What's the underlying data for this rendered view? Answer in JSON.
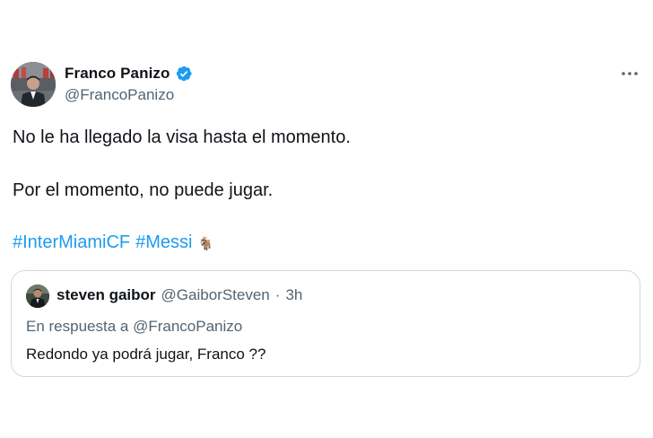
{
  "author": {
    "name": "Franco Panizo",
    "handle": "@FrancoPanizo",
    "verified": true,
    "verified_color": "#1d9bf0"
  },
  "tweet": {
    "line1": "No le ha llegado la visa hasta el momento.",
    "line2": "Por el momento, no puede jugar.",
    "hashtags": [
      "#InterMiamiCF",
      "#Messi"
    ],
    "emoji": "🐐"
  },
  "quoted": {
    "name": "steven gaibor",
    "handle": "@GaiborSteven",
    "separator": "·",
    "time": "3h",
    "reply_prefix": "En respuesta a",
    "reply_handle": "@FrancoPanizo",
    "text": "Redondo ya podrá jugar, Franco ??"
  },
  "icons": {
    "more": "more-dots-icon",
    "verified": "verified-badge-icon"
  },
  "colors": {
    "link": "#1d9bf0",
    "secondary_text": "#536471",
    "primary_text": "#0f1419",
    "border": "#cfd9de"
  }
}
